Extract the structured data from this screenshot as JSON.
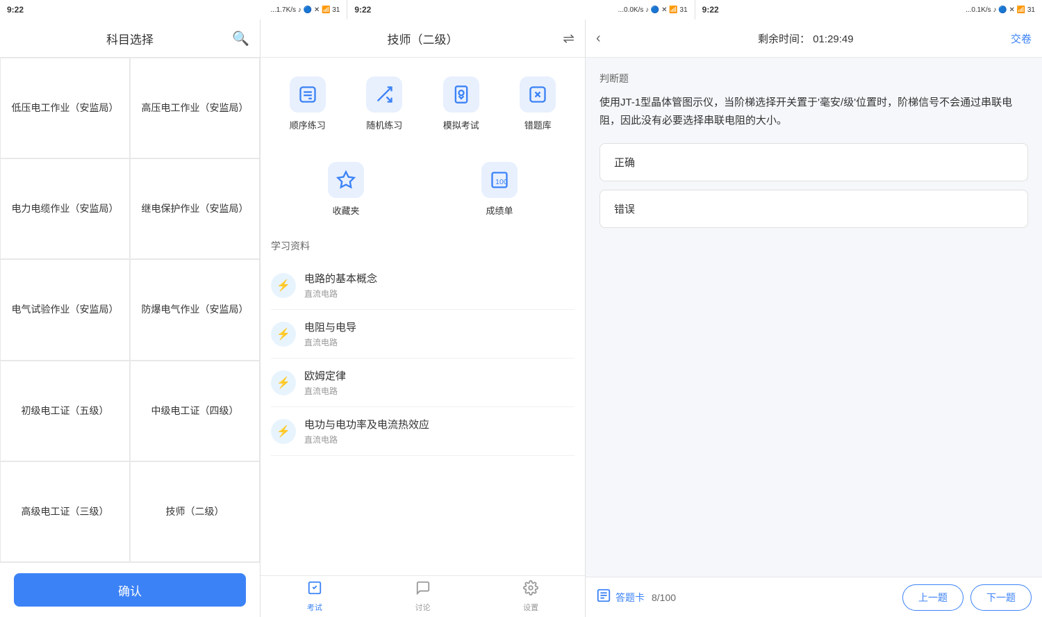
{
  "statusBars": [
    {
      "time": "9:22",
      "network": "...1.7K/s",
      "icons": "🔵 ✕ 📶 31"
    },
    {
      "time": "9:22",
      "network": "...0.0K/s",
      "icons": "🔵 ✕ 📶 31"
    },
    {
      "time": "9:22",
      "network": "...0.1K/s",
      "icons": "🔵 ✕ 📶 31"
    }
  ],
  "subjectPanel": {
    "title": "科目选择",
    "searchIcon": "🔍",
    "subjects": [
      "低压电工作业（安监局）",
      "高压电工作业（安监局）",
      "电力电缆作业（安监局）",
      "继电保护作业（安监局）",
      "电气试验作业（安监局）",
      "防爆电气作业（安监局）",
      "初级电工证（五级）",
      "中级电工证（四级）",
      "高级电工证（三级）",
      "技师（二级）"
    ],
    "confirmLabel": "确认"
  },
  "studyPanel": {
    "title": "技师（二级）",
    "exchangeIcon": "⇌",
    "functions": [
      {
        "icon": "📝",
        "label": "顺序练习"
      },
      {
        "icon": "🔀",
        "label": "随机练习"
      },
      {
        "icon": "🕐",
        "label": "模拟考试"
      },
      {
        "icon": "❌",
        "label": "错题库"
      },
      {
        "icon": "⭐",
        "label": "收藏夹"
      },
      {
        "icon": "📊",
        "label": "成绩单"
      }
    ],
    "materialSectionTitle": "学习资料",
    "materials": [
      {
        "title": "电路的基本概念",
        "sub": "直流电路"
      },
      {
        "title": "电阻与电导",
        "sub": "直流电路"
      },
      {
        "title": "欧姆定律",
        "sub": "直流电路"
      },
      {
        "title": "电功与电功率及电流热效应",
        "sub": "直流电路"
      }
    ],
    "bottomNav": [
      {
        "icon": "📋",
        "label": "考试",
        "active": true
      },
      {
        "icon": "💬",
        "label": "讨论",
        "active": false
      },
      {
        "icon": "⚙️",
        "label": "设置",
        "active": false
      }
    ]
  },
  "examPanel": {
    "backIcon": "‹",
    "timerLabel": "剩余时间：",
    "timerValue": "01:29:49",
    "submitLabel": "交卷",
    "questionType": "判断题",
    "questionText": "使用JT-1型晶体管图示仪，当阶梯选择开关置于'毫安/级'位置时，阶梯信号不会通过串联电阻，因此没有必要选择串联电阻的大小。",
    "options": [
      {
        "label": "正确"
      },
      {
        "label": "错误"
      }
    ],
    "footer": {
      "answerCardIcon": "📋",
      "answerCardLabel": "答题卡",
      "progress": "8/100",
      "prevLabel": "上一题",
      "nextLabel": "下一题"
    }
  }
}
